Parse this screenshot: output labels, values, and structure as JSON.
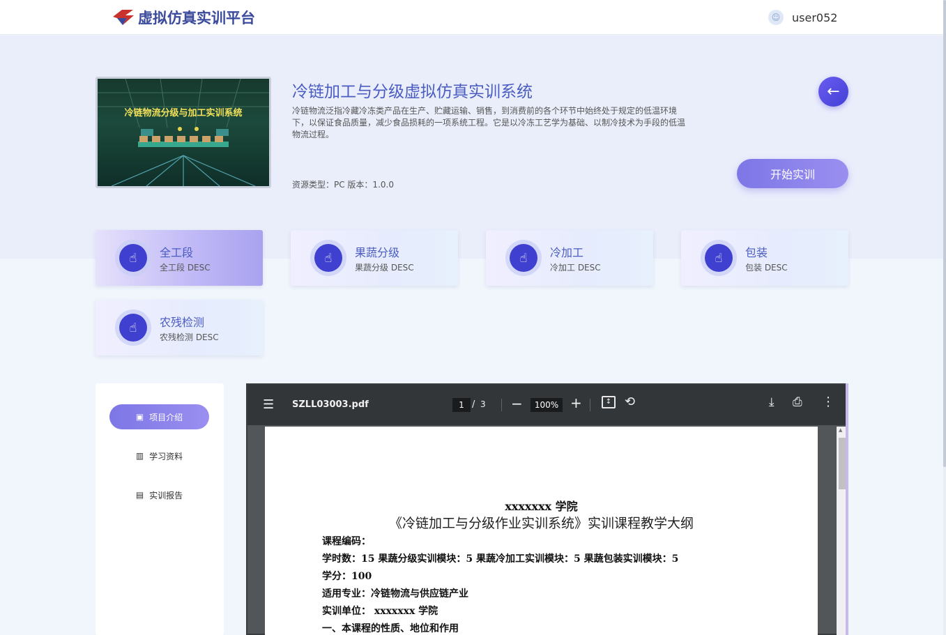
{
  "header": {
    "brand": "虚拟仿真实训平台",
    "username": "user052"
  },
  "project": {
    "cover_text": "冷链物流分级与加工实训系统",
    "title": "冷链加工与分级虚拟仿真实训系统",
    "description_lines": [
      "冷链物流泛指冷藏冷冻类产品在生产、贮藏运输、销售，到消费前的各个环节中始终处于规定的低温环境",
      "下，以保证食品质量，减少食品损耗的一项系统工程。它是以冷冻工艺学为基础、以制冷技术为手段的低温",
      "物流过程。"
    ],
    "meta": "资源类型：PC  版本：1.0.0",
    "start_label": "开始实训",
    "back_icon": "arrow-left-icon"
  },
  "modules": [
    {
      "name": "全工段",
      "desc": "全工段 DESC",
      "active": true
    },
    {
      "name": "果蔬分级",
      "desc": "果蔬分级 DESC",
      "active": false
    },
    {
      "name": "冷加工",
      "desc": "冷加工 DESC",
      "active": false
    },
    {
      "name": "包装",
      "desc": "包装 DESC",
      "active": false
    },
    {
      "name": "农残检测",
      "desc": "农残检测 DESC",
      "active": false
    }
  ],
  "sidebar": {
    "items": [
      {
        "label": "项目介绍",
        "icon": "book-icon",
        "active": true
      },
      {
        "label": "学习资料",
        "icon": "library-icon",
        "active": false
      },
      {
        "label": "实训报告",
        "icon": "report-icon",
        "active": false
      }
    ]
  },
  "pdf": {
    "filename": "SZLL03003.pdf",
    "current_page": "1",
    "page_sep": "/",
    "total_pages": "3",
    "zoom": "100%",
    "doc": {
      "school": "xxxxxxx 学院",
      "title": "《冷链加工与分级作业实训系统》实训课程教学大纲",
      "lines": [
        "课程编码：",
        "学时数：15    果蔬分级实训模块：5  果蔬冷加工实训模块：5  果蔬包装实训模块：5",
        "学分：100",
        "适用专业：冷链物流与供应链产业",
        "实训单位：  xxxxxxx 学院",
        "一、本课程的性质、地位和作用"
      ]
    }
  },
  "colors": {
    "accent": "#4a5cc2",
    "button_gradient_start": "#7d76e6",
    "button_gradient_end": "#9a8ff0",
    "toolbar": "#323639"
  }
}
